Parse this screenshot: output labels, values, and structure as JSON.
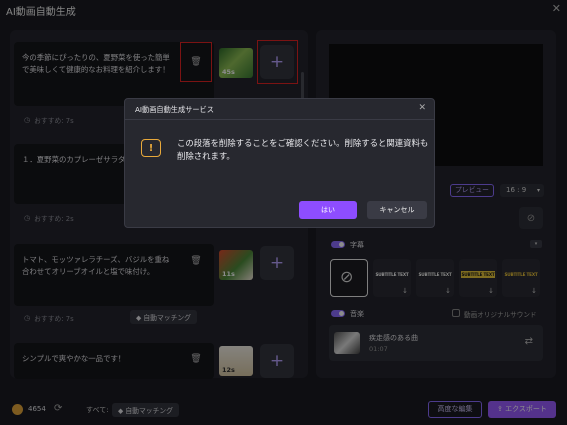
{
  "window": {
    "title": "AI動画自動生成",
    "close": "✕"
  },
  "segments": [
    {
      "text": "今の季節にぴったりの、夏野菜を使った簡単で美味しくて健康的なお料理を紹介します！",
      "duration": "45s",
      "recommend": "おすすめ: 7s"
    },
    {
      "text": "１．夏野菜のカプレーゼサラダ",
      "recommend": "おすすめ: 2s"
    },
    {
      "text": "トマト、モッツァレラチーズ、バジルを重ね合わせてオリーブオイルと塩で味付け。",
      "duration": "11s",
      "recommend": "おすすめ: 7s",
      "automatch": "自動マッチング"
    },
    {
      "text": "シンプルで爽やかな一品です！",
      "duration": "12s"
    }
  ],
  "right_panel": {
    "preview_label": "プレビュー",
    "ratio": "16 : 9",
    "subtitle_label": "字幕",
    "subtitle_styles": [
      "SUBTITLE TEXT",
      "SUBTITLE TEXT",
      "SUBTITLE TEXT",
      "SUBTITLE TEXT"
    ],
    "music_label": "音楽",
    "original_sound_label": "動画オリジナルサウンド",
    "music_title": "疾走感のある曲",
    "music_duration": "01:07"
  },
  "bottom": {
    "credits": "4654",
    "all_label": "すべて:",
    "automatch": "自動マッチング",
    "advanced_edit": "高度な編集",
    "export": "エクスポート"
  },
  "dialog": {
    "title": "AI動画自動生成サービス",
    "message": "この段落を削除することをご確認ください。削除すると関連資料も削除されます。",
    "yes": "はい",
    "cancel": "キャンセル"
  },
  "colors": {
    "accent": "#8e4dff",
    "highlight": "#e02424",
    "warning": "#e8a93b"
  }
}
